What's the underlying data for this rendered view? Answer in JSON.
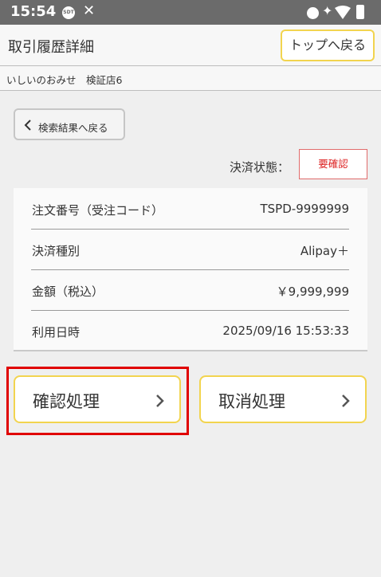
{
  "status_bar": {
    "time": "15:54",
    "sdt_badge": "SDT",
    "x_glyph": "✕"
  },
  "header": {
    "title": "取引履歴詳細",
    "top_button_label": "トップへ戻る"
  },
  "shop": {
    "name": "いしいのおみせ　検証店6"
  },
  "back_button": {
    "label": "検索結果へ戻る"
  },
  "payment_status": {
    "label": "決済状態：",
    "value": "要確認"
  },
  "details": [
    {
      "label": "注文番号（受注コード）",
      "value": "TSPD-9999999"
    },
    {
      "label": "決済種別",
      "value": "Alipay＋"
    },
    {
      "label": "金額（税込）",
      "value": "￥9,999,999"
    },
    {
      "label": "利用日時",
      "value": "2025/09/16 15:53:33"
    }
  ],
  "actions": {
    "confirm_label": "確認処理",
    "cancel_label": "取消処理"
  },
  "colors": {
    "accent_border": "#f2d44f",
    "status_red": "#d22222",
    "highlight_red": "#e00000",
    "status_bar": "#6b6b6b",
    "background": "#efefef"
  }
}
